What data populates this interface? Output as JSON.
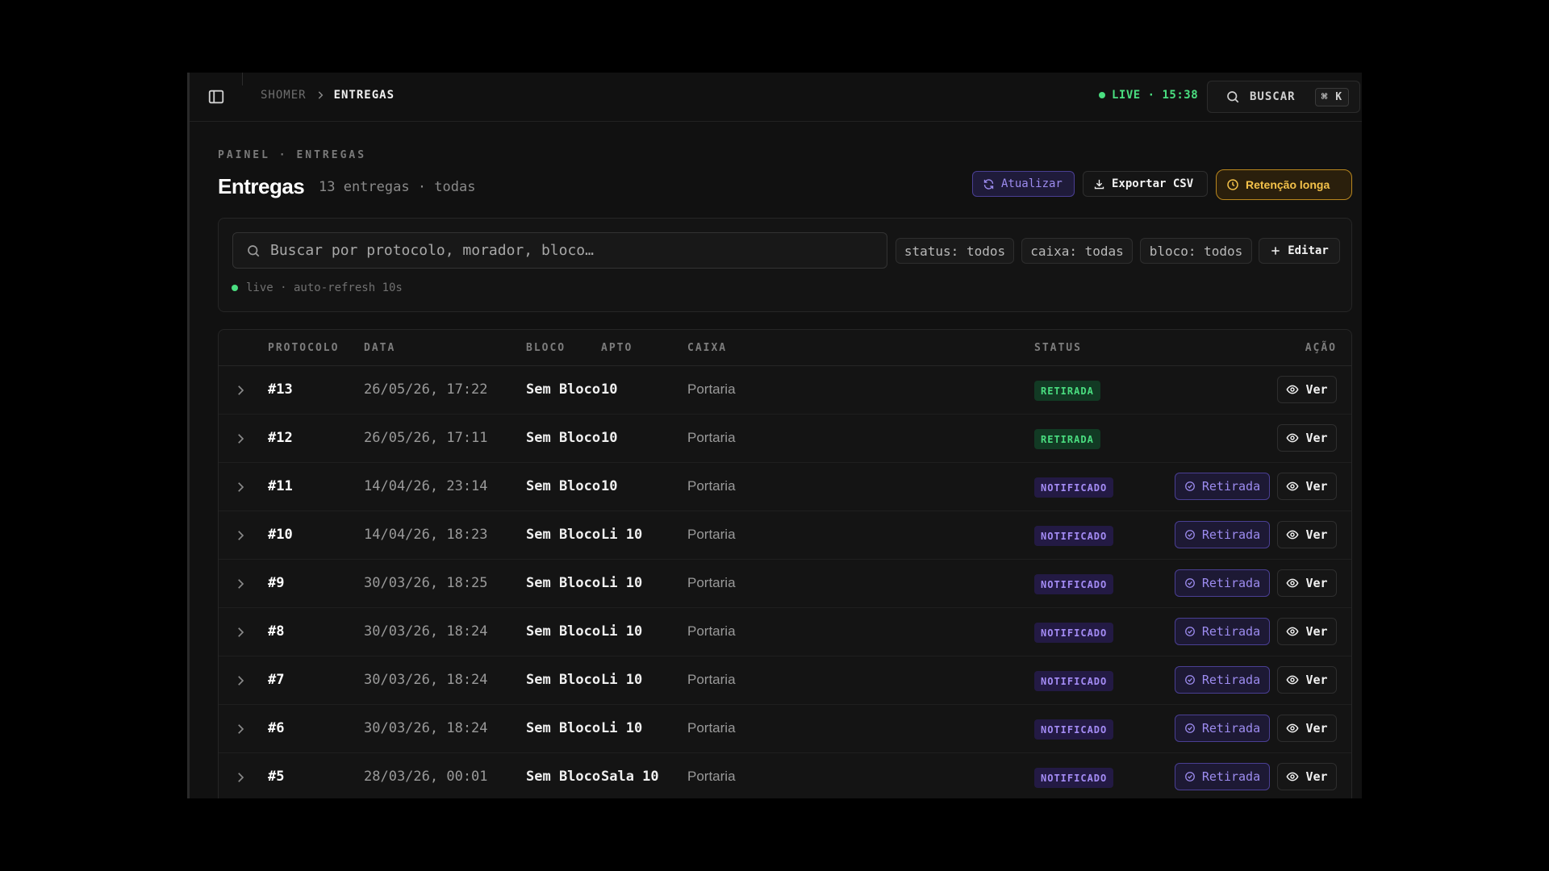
{
  "topbar": {
    "breadcrumb_root": "SHOMER",
    "breadcrumb_current": "ENTREGAS",
    "live_label": "LIVE · 15:38",
    "search_label": "BUSCAR",
    "search_shortcut": "⌘ K"
  },
  "header": {
    "eyebrow": "PAINEL · ENTREGAS",
    "title": "Entregas",
    "subtitle": "13 entregas · todas",
    "refresh_label": "Atualizar",
    "export_label": "Exportar CSV",
    "retention_label": "Retenção longa"
  },
  "filters": {
    "search_placeholder": "Buscar por protocolo, morador, bloco…",
    "status_chip": "status: todos",
    "caixa_chip": "caixa: todas",
    "bloco_chip": "bloco: todos",
    "edit_label": "Editar",
    "live_status": "live · auto-refresh 10s"
  },
  "table": {
    "columns": {
      "protocolo": "PROTOCOLO",
      "data": "DATA",
      "bloco": "BLOCO",
      "apto": "APTO",
      "caixa": "CAIXA",
      "status": "STATUS",
      "acao": "AÇÃO"
    },
    "pickup_label": "Retirada",
    "view_label": "Ver",
    "rows": [
      {
        "protocolo": "#13",
        "data": "26/05/26, 17:22",
        "bloco": "Sem Bloco",
        "apto": "10",
        "caixa": "Portaria",
        "status": "RETIRADA",
        "status_kind": "retirada"
      },
      {
        "protocolo": "#12",
        "data": "26/05/26, 17:11",
        "bloco": "Sem Bloco",
        "apto": "10",
        "caixa": "Portaria",
        "status": "RETIRADA",
        "status_kind": "retirada"
      },
      {
        "protocolo": "#11",
        "data": "14/04/26, 23:14",
        "bloco": "Sem Bloco",
        "apto": "10",
        "caixa": "Portaria",
        "status": "NOTIFICADO",
        "status_kind": "notificado"
      },
      {
        "protocolo": "#10",
        "data": "14/04/26, 18:23",
        "bloco": "Sem Bloco",
        "apto": "Li 10",
        "caixa": "Portaria",
        "status": "NOTIFICADO",
        "status_kind": "notificado"
      },
      {
        "protocolo": "#9",
        "data": "30/03/26, 18:25",
        "bloco": "Sem Bloco",
        "apto": "Li 10",
        "caixa": "Portaria",
        "status": "NOTIFICADO",
        "status_kind": "notificado"
      },
      {
        "protocolo": "#8",
        "data": "30/03/26, 18:24",
        "bloco": "Sem Bloco",
        "apto": "Li 10",
        "caixa": "Portaria",
        "status": "NOTIFICADO",
        "status_kind": "notificado"
      },
      {
        "protocolo": "#7",
        "data": "30/03/26, 18:24",
        "bloco": "Sem Bloco",
        "apto": "Li 10",
        "caixa": "Portaria",
        "status": "NOTIFICADO",
        "status_kind": "notificado"
      },
      {
        "protocolo": "#6",
        "data": "30/03/26, 18:24",
        "bloco": "Sem Bloco",
        "apto": "Li 10",
        "caixa": "Portaria",
        "status": "NOTIFICADO",
        "status_kind": "notificado"
      },
      {
        "protocolo": "#5",
        "data": "28/03/26, 00:01",
        "bloco": "Sem Bloco",
        "apto": "Sala 10",
        "caixa": "Portaria",
        "status": "NOTIFICADO",
        "status_kind": "notificado"
      }
    ]
  },
  "colors": {
    "accent_purple": "#9d8cf0",
    "live_green": "#4ade80",
    "warning_amber": "#f4c24a"
  }
}
